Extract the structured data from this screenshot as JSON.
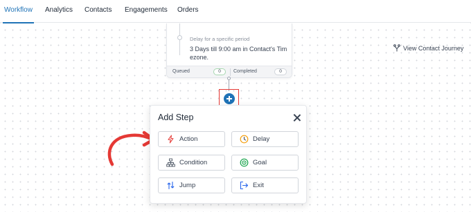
{
  "nav": {
    "tabs": [
      {
        "label": "Workflow",
        "active": true
      },
      {
        "label": "Analytics",
        "active": false
      },
      {
        "label": "Contacts",
        "active": false
      },
      {
        "label": "Engagements",
        "active": false
      },
      {
        "label": "Orders",
        "active": false
      }
    ]
  },
  "step_card": {
    "subtitle": "Delay for a specific period",
    "description": "3 Days till 9:00 am in Contact's Timezone.",
    "queued_label": "Queued",
    "queued_count": "0",
    "completed_label": "Completed",
    "completed_count": "0"
  },
  "journey_link": {
    "label": "View Contact Journey",
    "icon": "branch-icon"
  },
  "add_step_popup": {
    "title": "Add Step",
    "options": [
      {
        "label": "Action",
        "icon": "lightning-icon"
      },
      {
        "label": "Delay",
        "icon": "clock-icon"
      },
      {
        "label": "Condition",
        "icon": "hierarchy-icon"
      },
      {
        "label": "Goal",
        "icon": "target-icon"
      },
      {
        "label": "Jump",
        "icon": "jump-icon"
      },
      {
        "label": "Exit",
        "icon": "exit-icon"
      }
    ]
  },
  "colors": {
    "accent": "#1f73b7",
    "highlight_box": "#e53935",
    "annotation_arrow": "#e53935",
    "action_icon": "#e53935",
    "delay_icon": "#f59e0b",
    "condition_icon": "#4b5563",
    "goal_icon": "#16a34a",
    "jump_icon": "#2563eb",
    "exit_icon": "#2563eb"
  }
}
